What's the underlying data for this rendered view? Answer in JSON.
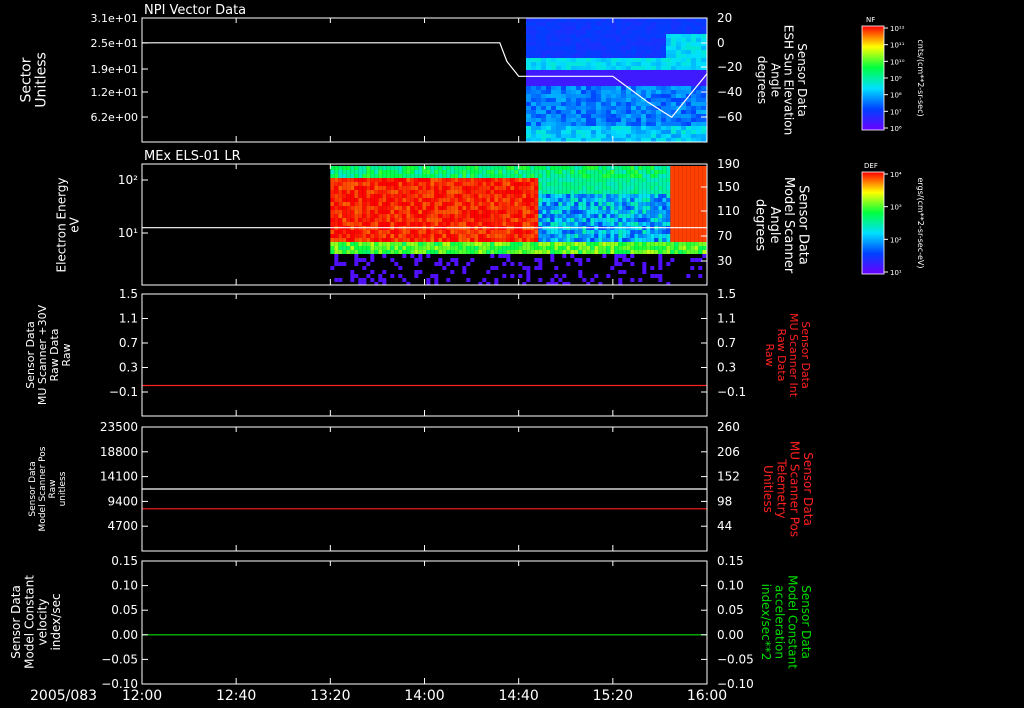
{
  "date_label": "2005/083",
  "x_ticks": [
    "12:00",
    "12:40",
    "13:20",
    "14:00",
    "14:40",
    "15:20",
    "16:00"
  ],
  "colors": {
    "background": "#000000",
    "frame": "#ffffff",
    "red_trace": "#ff2020",
    "green_trace": "#00dd00",
    "red_label": "#ff2020",
    "green_label": "#00dd00"
  },
  "chart_data": [
    {
      "type": "heatmap",
      "panel": "npi",
      "title": "NPI Vector Data",
      "ylabel": [
        "Sector",
        "Unitless"
      ],
      "y_ticks": [
        "3.1e+01",
        "2.5e+01",
        "1.9e+01",
        "1.2e+01",
        "6.2e+00"
      ],
      "y2label": [
        "Sensor Data",
        "ESH Sun Elevation",
        "Angle",
        "degrees"
      ],
      "y2_ticks": [
        "20",
        "0",
        "−20",
        "−40",
        "−60"
      ],
      "y2lim": [
        -80,
        20
      ],
      "data_start": "14:40",
      "line": {
        "x": [
          "12:00",
          "14:32",
          "14:35",
          "14:40",
          "15:20",
          "15:35",
          "15:45",
          "16:00"
        ],
        "y": [
          0,
          0,
          -15,
          -27,
          -27,
          -48,
          -60,
          -25
        ]
      },
      "colorbar": {
        "label": "NF",
        "unit": "cnts/(cm**2-sr-sec)",
        "ticks": [
          "10¹²",
          "10¹¹",
          "10¹⁰",
          "10⁹",
          "10⁸",
          "10⁷",
          "10⁶"
        ]
      }
    },
    {
      "type": "heatmap",
      "panel": "els",
      "title": "MEx ELS-01 LR",
      "ylabel": [
        "Electron Energy",
        "eV"
      ],
      "y_ticks": [
        "10²",
        "10¹"
      ],
      "y2label": [
        "Sensor Data",
        "Model Scanner",
        "Angle",
        "degrees"
      ],
      "y2_ticks": [
        "190",
        "150",
        "110",
        "70",
        "30"
      ],
      "y2lim": [
        0,
        190
      ],
      "data_start": "13:20",
      "line": {
        "x": [
          "12:00",
          "16:00"
        ],
        "y": [
          90,
          90
        ]
      },
      "colorbar": {
        "label": "DEF",
        "unit": "ergs/(cm**2-sr-sec-eV)",
        "ticks": [
          "10⁴",
          "10³",
          "10²",
          "10¹"
        ]
      }
    },
    {
      "type": "line",
      "panel": "mu_raw",
      "ylabel": [
        "Sensor Data",
        "MU Scanner +30V",
        "Raw Data",
        "Raw"
      ],
      "y_ticks": [
        "1.5",
        "1.1",
        "0.7",
        "0.3",
        "−0.1"
      ],
      "y2label": [
        "Sensor Data",
        "MU Scanner Int",
        "Raw Data",
        "Raw"
      ],
      "y2_ticks": [
        "1.5",
        "1.1",
        "0.7",
        "0.3",
        "−0.1"
      ],
      "ylim": [
        -0.5,
        1.5
      ],
      "series": [
        {
          "color": "red",
          "x": [
            "12:00",
            "16:00"
          ],
          "y": [
            0,
            0
          ]
        }
      ]
    },
    {
      "type": "line",
      "panel": "scanner_pos",
      "ylabel": [
        "Sensor Data",
        "Model Scanner Pos",
        "Raw",
        "unitless"
      ],
      "y_ticks": [
        "23500",
        "18800",
        "14100",
        "9400",
        "4700"
      ],
      "y2label": [
        "Sensor Data",
        "MU Scanner Pos",
        "Telemetry",
        "Unitless"
      ],
      "y2_ticks": [
        "260",
        "206",
        "152",
        "98",
        "44"
      ],
      "ylim": [
        0,
        23500
      ],
      "series": [
        {
          "color": "white",
          "x": [
            "12:00",
            "16:00"
          ],
          "y": [
            11750,
            11750
          ]
        },
        {
          "color": "red",
          "x": [
            "12:00",
            "16:00"
          ],
          "y": [
            8000,
            8000
          ]
        }
      ]
    },
    {
      "type": "line",
      "panel": "velocity",
      "ylabel": [
        "Sensor Data",
        "Model Constant",
        "velocity",
        "index/sec"
      ],
      "y_ticks": [
        "0.15",
        "0.10",
        "0.05",
        "0.00",
        "−0.05",
        "−0.10"
      ],
      "y2label": [
        "Sensor Data",
        "Model Constant",
        "acceleration",
        "index/sec**2"
      ],
      "y2_ticks": [
        "0.15",
        "0.10",
        "0.05",
        "0.00",
        "−0.05",
        "−0.10"
      ],
      "ylim": [
        -0.1,
        0.15
      ],
      "series": [
        {
          "color": "green",
          "x": [
            "12:00",
            "16:00"
          ],
          "y": [
            0,
            0
          ]
        }
      ]
    }
  ]
}
